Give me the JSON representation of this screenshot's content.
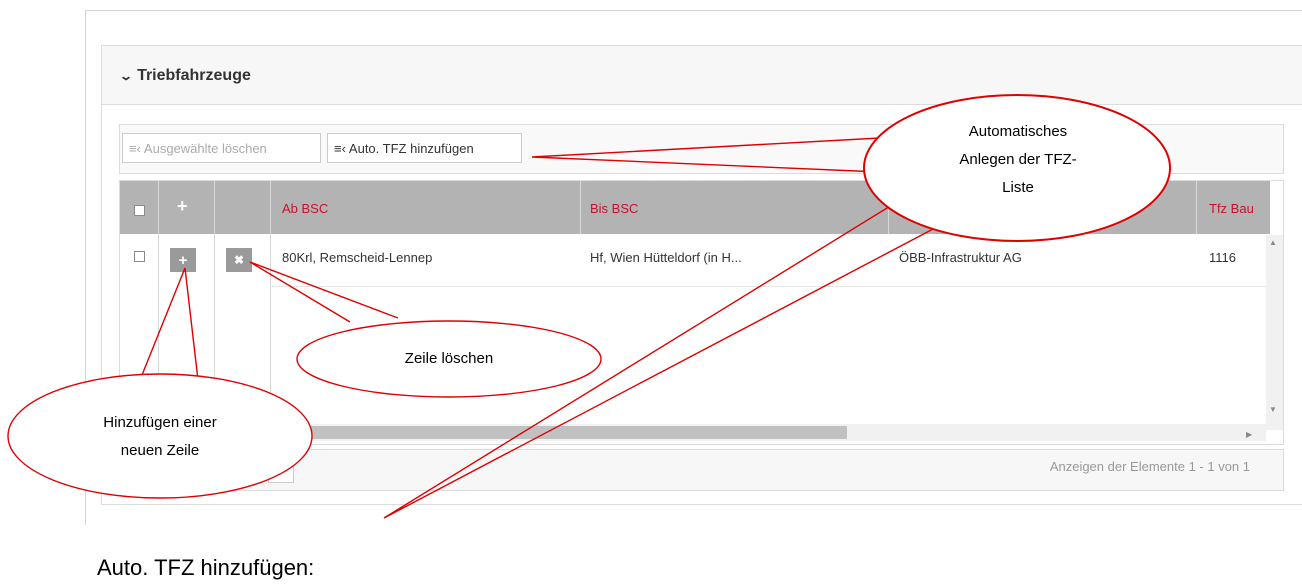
{
  "panel": {
    "title": "Triebfahrzeuge",
    "toggle_icon": "chevron-down-icon"
  },
  "toolbar": {
    "delete_selected_label": "Ausgewählte löschen",
    "auto_add_label": "Auto. TFZ hinzufügen",
    "icon": "list-add-icon"
  },
  "grid": {
    "header_add_symbol": "+",
    "columns": [
      "Ab BSC",
      "Bis BSC",
      "",
      "Tfz Bau"
    ],
    "rows": [
      {
        "add_symbol": "+",
        "delete_symbol": "✖",
        "cells": [
          "80Krl, Remscheid-Lennep",
          "Hf, Wien Hütteldorf (in H...",
          "ÖBB-Infrastruktur AG",
          "1116"
        ]
      }
    ],
    "footer_text": "Anzeigen der Elemente 1 - 1 von 1"
  },
  "annotations": {
    "auto_callout": [
      "Automatisches",
      "Anlegen der TFZ-",
      "Liste"
    ],
    "delete_callout": "Zeile löschen",
    "add_callout": [
      "Hinzufügen einer",
      "neuen Zeile"
    ],
    "callout_color": "#e00000"
  },
  "caption": "Auto. TFZ hinzufügen:",
  "colors": {
    "header_bg": "#b3b3b3",
    "header_text": "#c8102e",
    "button_bg": "#9a9a9a"
  }
}
